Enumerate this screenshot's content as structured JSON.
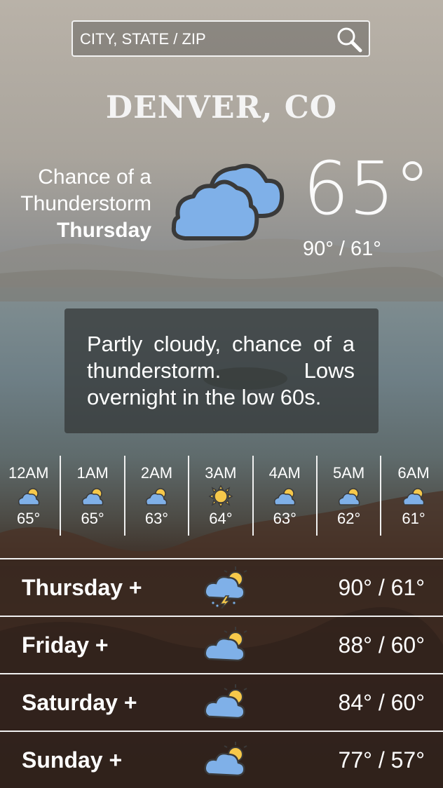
{
  "search": {
    "placeholder": "CITY, STATE / ZIP"
  },
  "location": {
    "city": "DENVER, CO"
  },
  "current": {
    "condition_line1": "Chance of a",
    "condition_line2": "Thunderstorm",
    "day": "Thursday",
    "temp": "65°",
    "hi_lo": "90° / 61°",
    "icon": "cloudy-icon"
  },
  "description": "Partly cloudy, chance of a thunderstorm. Lows overnight in the low 60s.",
  "hourly": [
    {
      "time": "12AM",
      "temp": "65°",
      "icon": "partly-cloudy-icon"
    },
    {
      "time": "1AM",
      "temp": "65°",
      "icon": "partly-cloudy-icon"
    },
    {
      "time": "2AM",
      "temp": "63°",
      "icon": "partly-cloudy-icon"
    },
    {
      "time": "3AM",
      "temp": "64°",
      "icon": "sun-icon"
    },
    {
      "time": "4AM",
      "temp": "63°",
      "icon": "partly-cloudy-icon"
    },
    {
      "time": "5AM",
      "temp": "62°",
      "icon": "partly-cloudy-icon"
    },
    {
      "time": "6AM",
      "temp": "61°",
      "icon": "partly-cloudy-icon"
    }
  ],
  "daily": [
    {
      "day": "Thursday +",
      "range": "90° / 61°",
      "icon": "thunderstorm-icon"
    },
    {
      "day": "Friday +",
      "range": "88° / 60°",
      "icon": "partly-cloudy-icon"
    },
    {
      "day": "Saturday +",
      "range": "84° / 60°",
      "icon": "partly-cloudy-icon"
    },
    {
      "day": "Sunday +",
      "range": "77° / 57°",
      "icon": "partly-cloudy-icon"
    }
  ],
  "colors": {
    "cloud": "#7fb0e8",
    "sun": "#f6c84a",
    "outline": "#3a3a3a"
  }
}
